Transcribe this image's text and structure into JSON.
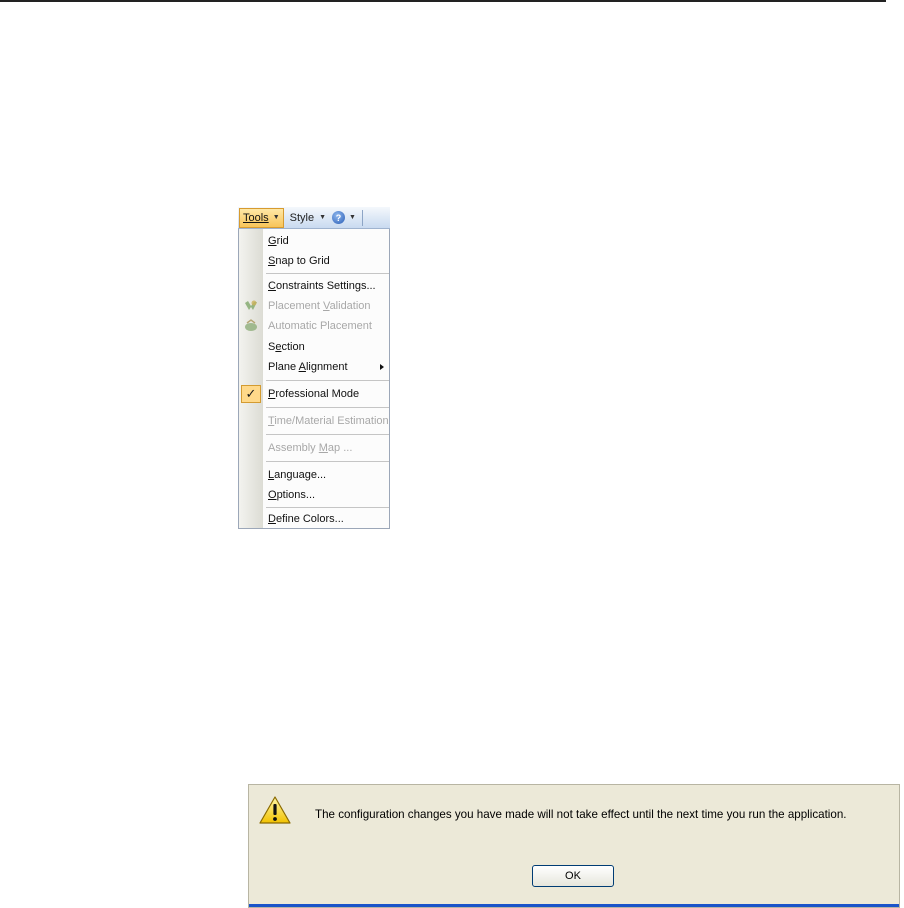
{
  "toolbar": {
    "tools_label": "Tools",
    "style_label": "Style",
    "help_glyph": "?"
  },
  "menu": {
    "items": [
      {
        "pre": "",
        "u": "G",
        "post": "rid"
      },
      {
        "pre": "",
        "u": "S",
        "post": "nap to Grid"
      },
      {
        "pre": "",
        "u": "C",
        "post": "onstraints Settings..."
      },
      {
        "pre": "Placement ",
        "u": "V",
        "post": "alidation",
        "icon": "placement-validation-icon"
      },
      {
        "pre": "Automatic Placement",
        "u": "",
        "post": "",
        "icon": "automatic-placement-icon"
      },
      {
        "pre": "S",
        "u": "e",
        "post": "ction"
      },
      {
        "pre": "Plane ",
        "u": "A",
        "post": "lignment"
      },
      {
        "pre": "",
        "u": "P",
        "post": "rofessional Mode",
        "checked": true
      },
      {
        "pre": "",
        "u": "T",
        "post": "ime/Material Estimation"
      },
      {
        "pre": "Assembly ",
        "u": "M",
        "post": "ap ..."
      },
      {
        "pre": "",
        "u": "L",
        "post": "anguage..."
      },
      {
        "pre": "",
        "u": "O",
        "post": "ptions..."
      },
      {
        "pre": "",
        "u": "D",
        "post": "efine Colors..."
      }
    ]
  },
  "dialog": {
    "message": "The configuration changes you have made will not take effect until the next time you run the application.",
    "ok_label": "OK",
    "icon": "warning-icon"
  }
}
